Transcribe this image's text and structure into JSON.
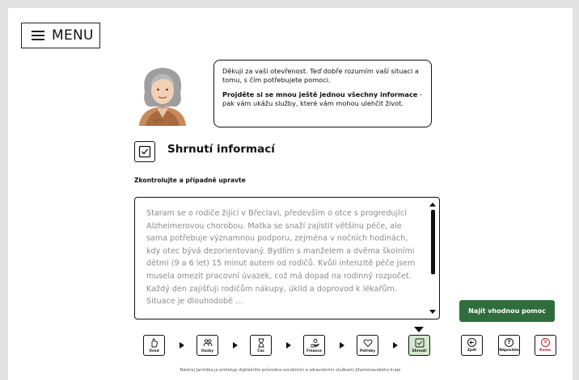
{
  "menu": {
    "label": "MENU"
  },
  "assistant": {
    "message_1": "Děkuji za vaši otevřenost. Teď dobře rozumím vaší situaci a tomu, s čím potřebujete pomoci.",
    "message_2_bold": "Projděte si se mnou ještě jednou všechny informace",
    "message_2_rest": " - pak vám ukážu služby, které vám mohou ulehčit život."
  },
  "summary": {
    "title": "Shrnutí informací",
    "subtitle": "Zkontrolujte a případně upravte",
    "text": "Staram se o rodiče žijící v Břeclavi, především o otce s progredující Alzheimerovou chorobou. Matka se snaží zajistit většinu péče, ale sama potřebuje významnou podporu, zejména v nočních hodinách, kdy otec bývá dezorientovaný. Bydlím s manželem a dvěma školními dětmi (9 a 6 let) 15 minut autem od rodičů. Kvůli intenzitě péče jsem musela omezit pracovní úvazek, což má dopad na rodinný rozpočet. Každý den zajišťuji rodičům nákupy, úklid a doprovod k lékařům. Situace je dlouhodobě ..."
  },
  "actions": {
    "find_help": "Najít vhodnou pomoc"
  },
  "steps": [
    {
      "label": "Úvod",
      "icon": "hand-icon"
    },
    {
      "label": "Osoby",
      "icon": "people-icon"
    },
    {
      "label": "Čas",
      "icon": "hourglass-icon"
    },
    {
      "label": "Finance",
      "icon": "money-hand-icon"
    },
    {
      "label": "Potřeby",
      "icon": "heart-icon"
    },
    {
      "label": "Shrnutí",
      "icon": "checkbox-icon",
      "active": true
    }
  ],
  "controls": {
    "back": {
      "label": "Zpět",
      "icon": "back-arrow-icon"
    },
    "help": {
      "label": "Nápověda",
      "icon": "question-icon",
      "glyph": "?"
    },
    "end": {
      "label": "Konec",
      "icon": "close-icon",
      "glyph": "✕"
    }
  },
  "footer": "Nástroj Jarmilka je prototyp digitálního průvodce sociálními a zdravotními službami Jihomoravského kraje",
  "colors": {
    "primary_green": "#2f6e3b",
    "active_step": "#d3e9cd",
    "end_red": "#b3262f",
    "placeholder_text": "#8b8b8b"
  }
}
